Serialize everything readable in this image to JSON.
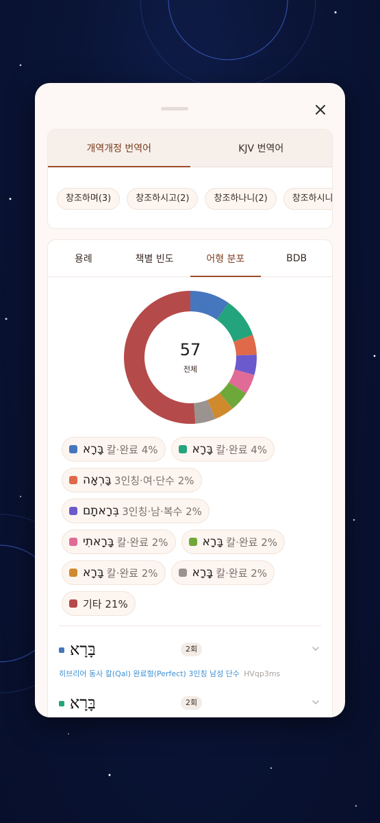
{
  "colors": {
    "accent": "#9b4c2a",
    "background": "#0a1436",
    "card": "#fdf8f5"
  },
  "sheet": {
    "close_icon": "close-icon"
  },
  "translation_tabs": [
    {
      "label": "개역개정 번역어",
      "active": true
    },
    {
      "label": "KJV 번역어",
      "active": false
    }
  ],
  "translation_chips": [
    "창조하며(3)",
    "창조하시고(2)",
    "창조하나니(2)",
    "창조하시니라"
  ],
  "main_tabs": [
    {
      "label": "용례",
      "active": false
    },
    {
      "label": "책별 빈도",
      "active": false
    },
    {
      "label": "어형 분포",
      "active": true
    },
    {
      "label": "BDB",
      "active": false
    }
  ],
  "chart_data": {
    "type": "pie",
    "total": "57",
    "total_caption": "전체",
    "slices": [
      {
        "hebrew": "בָּרָא",
        "label": "칼·완료 4%",
        "value": 4,
        "color": "#4676bd"
      },
      {
        "hebrew": "בָּרָא",
        "label": "칼·완료 4%",
        "value": 4,
        "color": "#24a47c"
      },
      {
        "hebrew": "בָּרְאָה",
        "label": "3인칭·여·단수 2%",
        "value": 2,
        "color": "#e0694a"
      },
      {
        "hebrew": "בְּרָאתָם",
        "label": "3인칭·남·복수 2%",
        "value": 2,
        "color": "#6a5acd"
      },
      {
        "hebrew": "בָּרָאתִי",
        "label": "칼·완료 2%",
        "value": 2,
        "color": "#e06b96"
      },
      {
        "hebrew": "בָּרָא",
        "label": "칼·완료 2%",
        "value": 2,
        "color": "#6fa83a"
      },
      {
        "hebrew": "בָּרָא",
        "label": "칼·완료 2%",
        "value": 2,
        "color": "#d08a2e"
      },
      {
        "hebrew": "בָּֽרָא",
        "label": "칼·완료 2%",
        "value": 2,
        "color": "#9a9390"
      },
      {
        "hebrew": "",
        "label": "기타 21%",
        "value": 21,
        "color": "#b54a4a"
      }
    ]
  },
  "forms": [
    {
      "hebrew": "בָּרָא",
      "count": "2회",
      "color": "#4676bd",
      "description": "히브리어 동사 칼(Qal) 완료형(Perfect) 3인칭 남성 단수",
      "code": "HVqp3ms"
    },
    {
      "hebrew": "בָּרָא",
      "count": "2회",
      "color": "#24a47c",
      "description": "",
      "code": ""
    }
  ]
}
